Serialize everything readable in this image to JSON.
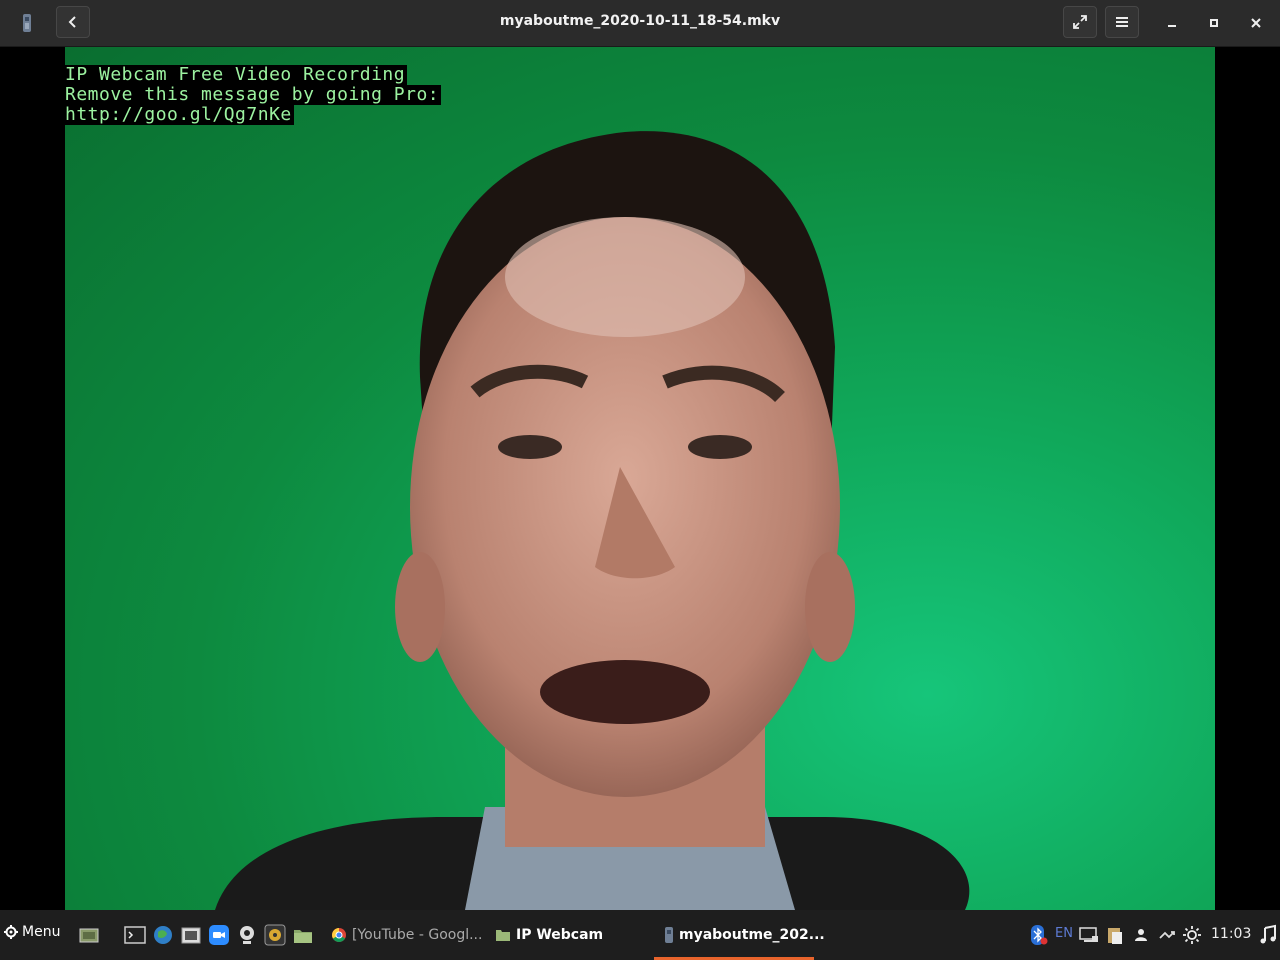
{
  "window": {
    "title": "myaboutme_2020-10-11_18-54.mkv",
    "icons": {
      "app": "video-player-icon",
      "back": "chevron-left-icon",
      "fullscreen": "expand-arrows-icon",
      "menu": "hamburger-menu-icon",
      "minimize": "minimize-icon",
      "maximize": "maximize-icon",
      "close": "close-icon"
    }
  },
  "video": {
    "overlay_lines": [
      "IP Webcam Free Video Recording",
      "Remove this message by going Pro:",
      "http://goo.gl/Qg7nKe"
    ],
    "background_color": "#0d8a3f"
  },
  "taskbar": {
    "menu_label": "Menu",
    "launchers": [
      "show-desktop-icon",
      "terminal-icon",
      "web-browser-icon",
      "screenshot-icon",
      "zoom-icon",
      "webcam-icon",
      "audio-recorder-icon",
      "files-icon"
    ],
    "tasks": [
      {
        "label": "[YouTube - Googl...",
        "icon": "chrome-icon"
      },
      {
        "label": "IP Webcam",
        "icon": "folder-icon"
      },
      {
        "label": "myaboutme_202...",
        "icon": "video-player-icon"
      }
    ],
    "tray": {
      "language": "EN",
      "clock": "11:03",
      "icons": [
        "bluetooth-icon",
        "display-icon",
        "clipboard-icon",
        "user-icon",
        "network-icon",
        "brightness-icon",
        "music-icon"
      ]
    },
    "accent_color": "#e8642c"
  }
}
